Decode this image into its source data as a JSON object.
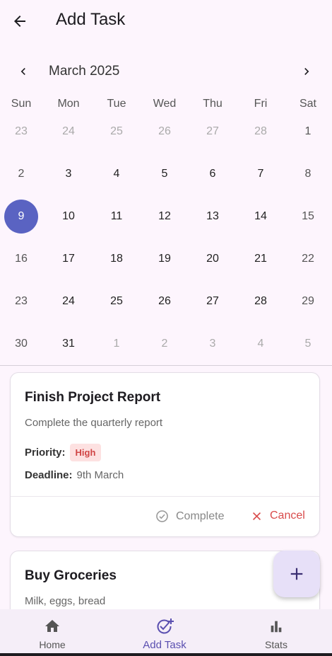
{
  "app_bar": {
    "title": "Add Task"
  },
  "calendar": {
    "month_label": "March 2025",
    "weekdays": [
      "Sun",
      "Mon",
      "Tue",
      "Wed",
      "Thu",
      "Fri",
      "Sat"
    ],
    "weeks": [
      [
        "23",
        "24",
        "25",
        "26",
        "27",
        "28",
        "1"
      ],
      [
        "2",
        "3",
        "4",
        "5",
        "6",
        "7",
        "8"
      ],
      [
        "9",
        "10",
        "11",
        "12",
        "13",
        "14",
        "15"
      ],
      [
        "16",
        "17",
        "18",
        "19",
        "20",
        "21",
        "22"
      ],
      [
        "23",
        "24",
        "25",
        "26",
        "27",
        "28",
        "29"
      ],
      [
        "30",
        "31",
        "1",
        "2",
        "3",
        "4",
        "5"
      ]
    ],
    "selected_day": "9",
    "accent": "#5a63c2"
  },
  "tasks": [
    {
      "title": "Finish Project Report",
      "description": "Complete the quarterly report",
      "priority_label": "Priority:",
      "priority": "High",
      "deadline_label": "Deadline:",
      "deadline": "9th March",
      "complete_label": "Complete",
      "cancel_label": "Cancel"
    },
    {
      "title": "Buy Groceries",
      "description": "Milk, eggs, bread"
    }
  ],
  "fab": {
    "icon": "plus-icon"
  },
  "bottom_nav": [
    {
      "label": "Home",
      "icon": "home-icon"
    },
    {
      "label": "Add Task",
      "icon": "calendar-add-icon"
    },
    {
      "label": "Stats",
      "icon": "bar-chart-icon"
    }
  ]
}
